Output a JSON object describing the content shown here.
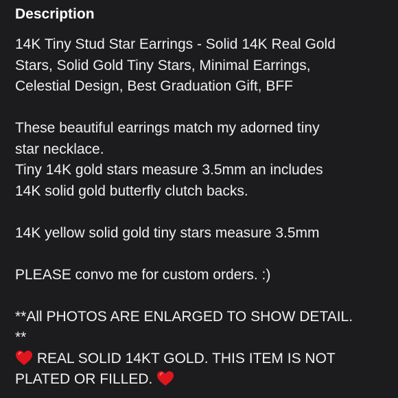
{
  "description": {
    "heading": "Description",
    "title_lines": [
      "14K Tiny Stud Star Earrings - Solid 14K Real Gold",
      "Stars, Solid Gold Tiny Stars, Minimal Earrings,",
      "Celestial Design, Best Graduation Gift, BFF"
    ],
    "para1_lines": [
      "These beautiful earrings match my adorned tiny",
      "star necklace.",
      "Tiny 14K gold stars measure 3.5mm an includes",
      "14K solid gold butterfly clutch backs."
    ],
    "para2": "14K yellow solid gold tiny stars measure 3.5mm",
    "para3": "PLEASE convo me for custom orders. :)",
    "photos_note_lines": [
      "**All PHOTOS ARE ENLARGED TO SHOW DETAIL.",
      "**"
    ],
    "gold_note_line1": "REAL SOLID 14KT GOLD. THIS ITEM IS NOT",
    "gold_note_line2": "PLATED OR FILLED.",
    "heart_icon": "red-heart-icon",
    "heart_color": "#e0161e"
  }
}
